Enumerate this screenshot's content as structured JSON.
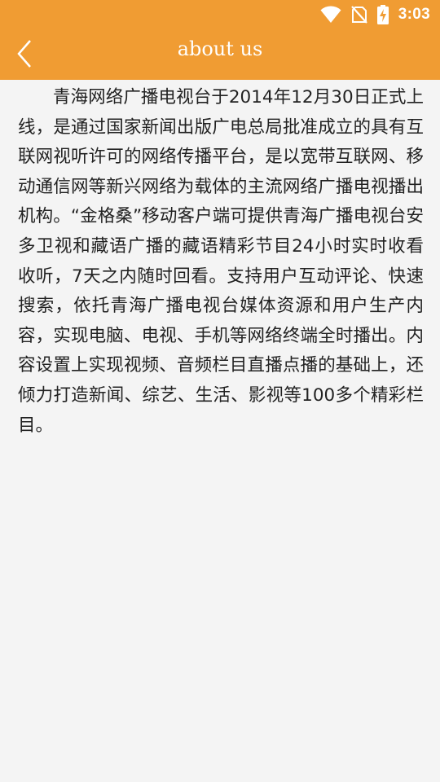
{
  "status_bar": {
    "time": "3:03",
    "icons": [
      "wifi-icon",
      "no-sim-icon",
      "battery-charging-icon"
    ]
  },
  "header": {
    "title": "about us",
    "back_icon": "chevron-left-icon",
    "color": "#f09c33"
  },
  "content": {
    "body": "青海网络广播电视台于2014年12月30日正式上线，是通过国家新闻出版广电总局批准成立的具有互联网视听许可的网络传播平台，是以宽带互联网、移动通信网等新兴网络为载体的主流网络广播电视播出机构。“金格桑”移动客户端可提供青海广播电视台安多卫视和藏语广播的藏语精彩节目24小时实时收看收听，7天之内随时回看。支持用户互动评论、快速搜索，依托青海广播电视台媒体资源和用户生产内容，实现电脑、电视、手机等网络终端全时播出。内容设置上实现视频、音频栏目直播点播的基础上，还倾力打造新闻、综艺、生活、影视等100多个精彩栏目。"
  }
}
